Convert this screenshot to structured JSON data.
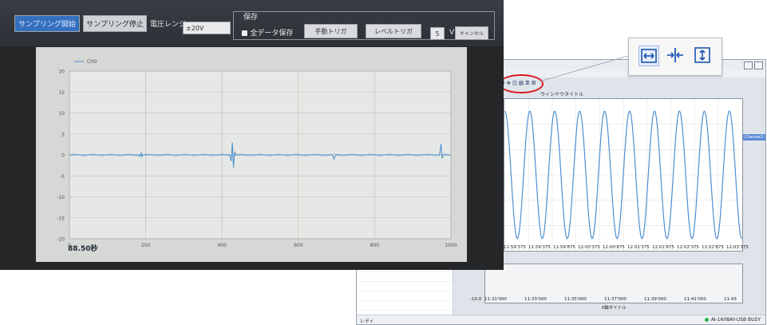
{
  "measure_app": {
    "sampling_start_label": "サンプリング開始",
    "sampling_stop_label": "サンプリング停止",
    "voltage_range_label": "電圧レンジ",
    "voltage_range_value": "±20V",
    "save_group_label": "保存",
    "save_all_label": "■ 全データ保存",
    "manual_trigger_label": "手動トリガ",
    "level_trigger_label": "レベルトリガ",
    "level_value": "5",
    "volt_unit": "V",
    "cancel_label": "キャンセル",
    "elapsed_time": "88.50秒"
  },
  "chart_data": {
    "type": "line",
    "series": [
      {
        "name": "CH0",
        "points": [
          [
            0,
            0
          ],
          [
            180,
            0
          ],
          [
            185,
            -0.3
          ],
          [
            188,
            0.6
          ],
          [
            190,
            -0.4
          ],
          [
            192,
            0
          ],
          [
            420,
            0
          ],
          [
            424,
            -1.5
          ],
          [
            427,
            3
          ],
          [
            430,
            -3
          ],
          [
            433,
            0.8
          ],
          [
            436,
            0
          ],
          [
            690,
            0
          ],
          [
            693,
            -1
          ],
          [
            696,
            -0.5
          ],
          [
            699,
            0
          ],
          [
            970,
            0
          ],
          [
            974,
            2.6
          ],
          [
            977,
            -0.8
          ],
          [
            980,
            0
          ],
          [
            1000,
            0
          ]
        ]
      }
    ],
    "x_ticks": [
      "0",
      "200",
      "400",
      "600",
      "800",
      "1000"
    ],
    "y_ticks": [
      "20",
      "15",
      "10",
      "5",
      "0",
      "-5",
      "-10",
      "-15",
      "-20"
    ],
    "xlim": [
      0,
      1000
    ],
    "ylim": [
      -20,
      20
    ],
    "grid": true,
    "legend_position": "top-left",
    "line_color": "#4a8fd0"
  },
  "software_window": {
    "window_subtitle": "ウィンドウタイトル",
    "legend_label": "Channel1",
    "x_ticks": [
      "11:59'375",
      "11:59'375",
      "11:59'875",
      "12:00'375",
      "12:00'875",
      "12:01'375",
      "12:01'875",
      "12:02'375",
      "12:02'875",
      "12:03'375"
    ],
    "lower_x_ticks": [
      "11:31'000",
      "11:33'000",
      "11:35'000",
      "11:37'000",
      "11:39'000",
      "11:41'000",
      "11:43"
    ],
    "lower_y_min": "-10.0",
    "lower_x_label": "X軸タイトル",
    "status_left": "レディ",
    "status_right": "AI-1608AY-USB BUSY",
    "signal_cycles": 9.5
  },
  "toolbar_callout": {
    "icons": [
      "zoom-x-expand-icon",
      "zoom-x-shrink-icon",
      "zoom-y-expand-icon"
    ],
    "selected_index": 0
  },
  "colors": {
    "highlight": "#d9181f",
    "signal": "#4a8fd0",
    "status_ok": "#27b24a"
  }
}
